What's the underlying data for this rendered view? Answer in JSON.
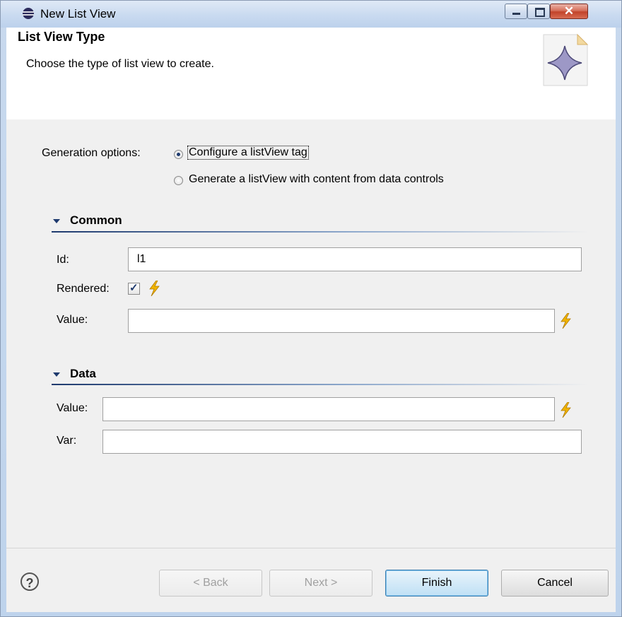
{
  "window": {
    "title": "New List View",
    "minimize_icon": "minimize-icon",
    "maximize_icon": "maximize-icon",
    "close_icon": "close-icon",
    "close_glyph": "✕"
  },
  "header": {
    "title": "List View Type",
    "subtitle": "Choose the type of list view to create."
  },
  "generation": {
    "label": "Generation options:",
    "options": [
      {
        "label": "Configure a listView tag",
        "selected": true
      },
      {
        "label": "Generate a listView with content from data controls",
        "selected": false
      }
    ]
  },
  "common": {
    "title": "Common",
    "id_label": "Id:",
    "id_value": "l1",
    "rendered_label": "Rendered:",
    "rendered_checked": true,
    "value_label": "Value:",
    "value_value": ""
  },
  "data_section": {
    "title": "Data",
    "value_label": "Value:",
    "value_value": "",
    "var_label": "Var:",
    "var_value": ""
  },
  "buttons": {
    "help": "?",
    "back": "< Back",
    "next": "Next >",
    "finish": "Finish",
    "cancel": "Cancel"
  },
  "colors": {
    "accent": "#1e3a6e",
    "bolt": "#f0b400"
  }
}
